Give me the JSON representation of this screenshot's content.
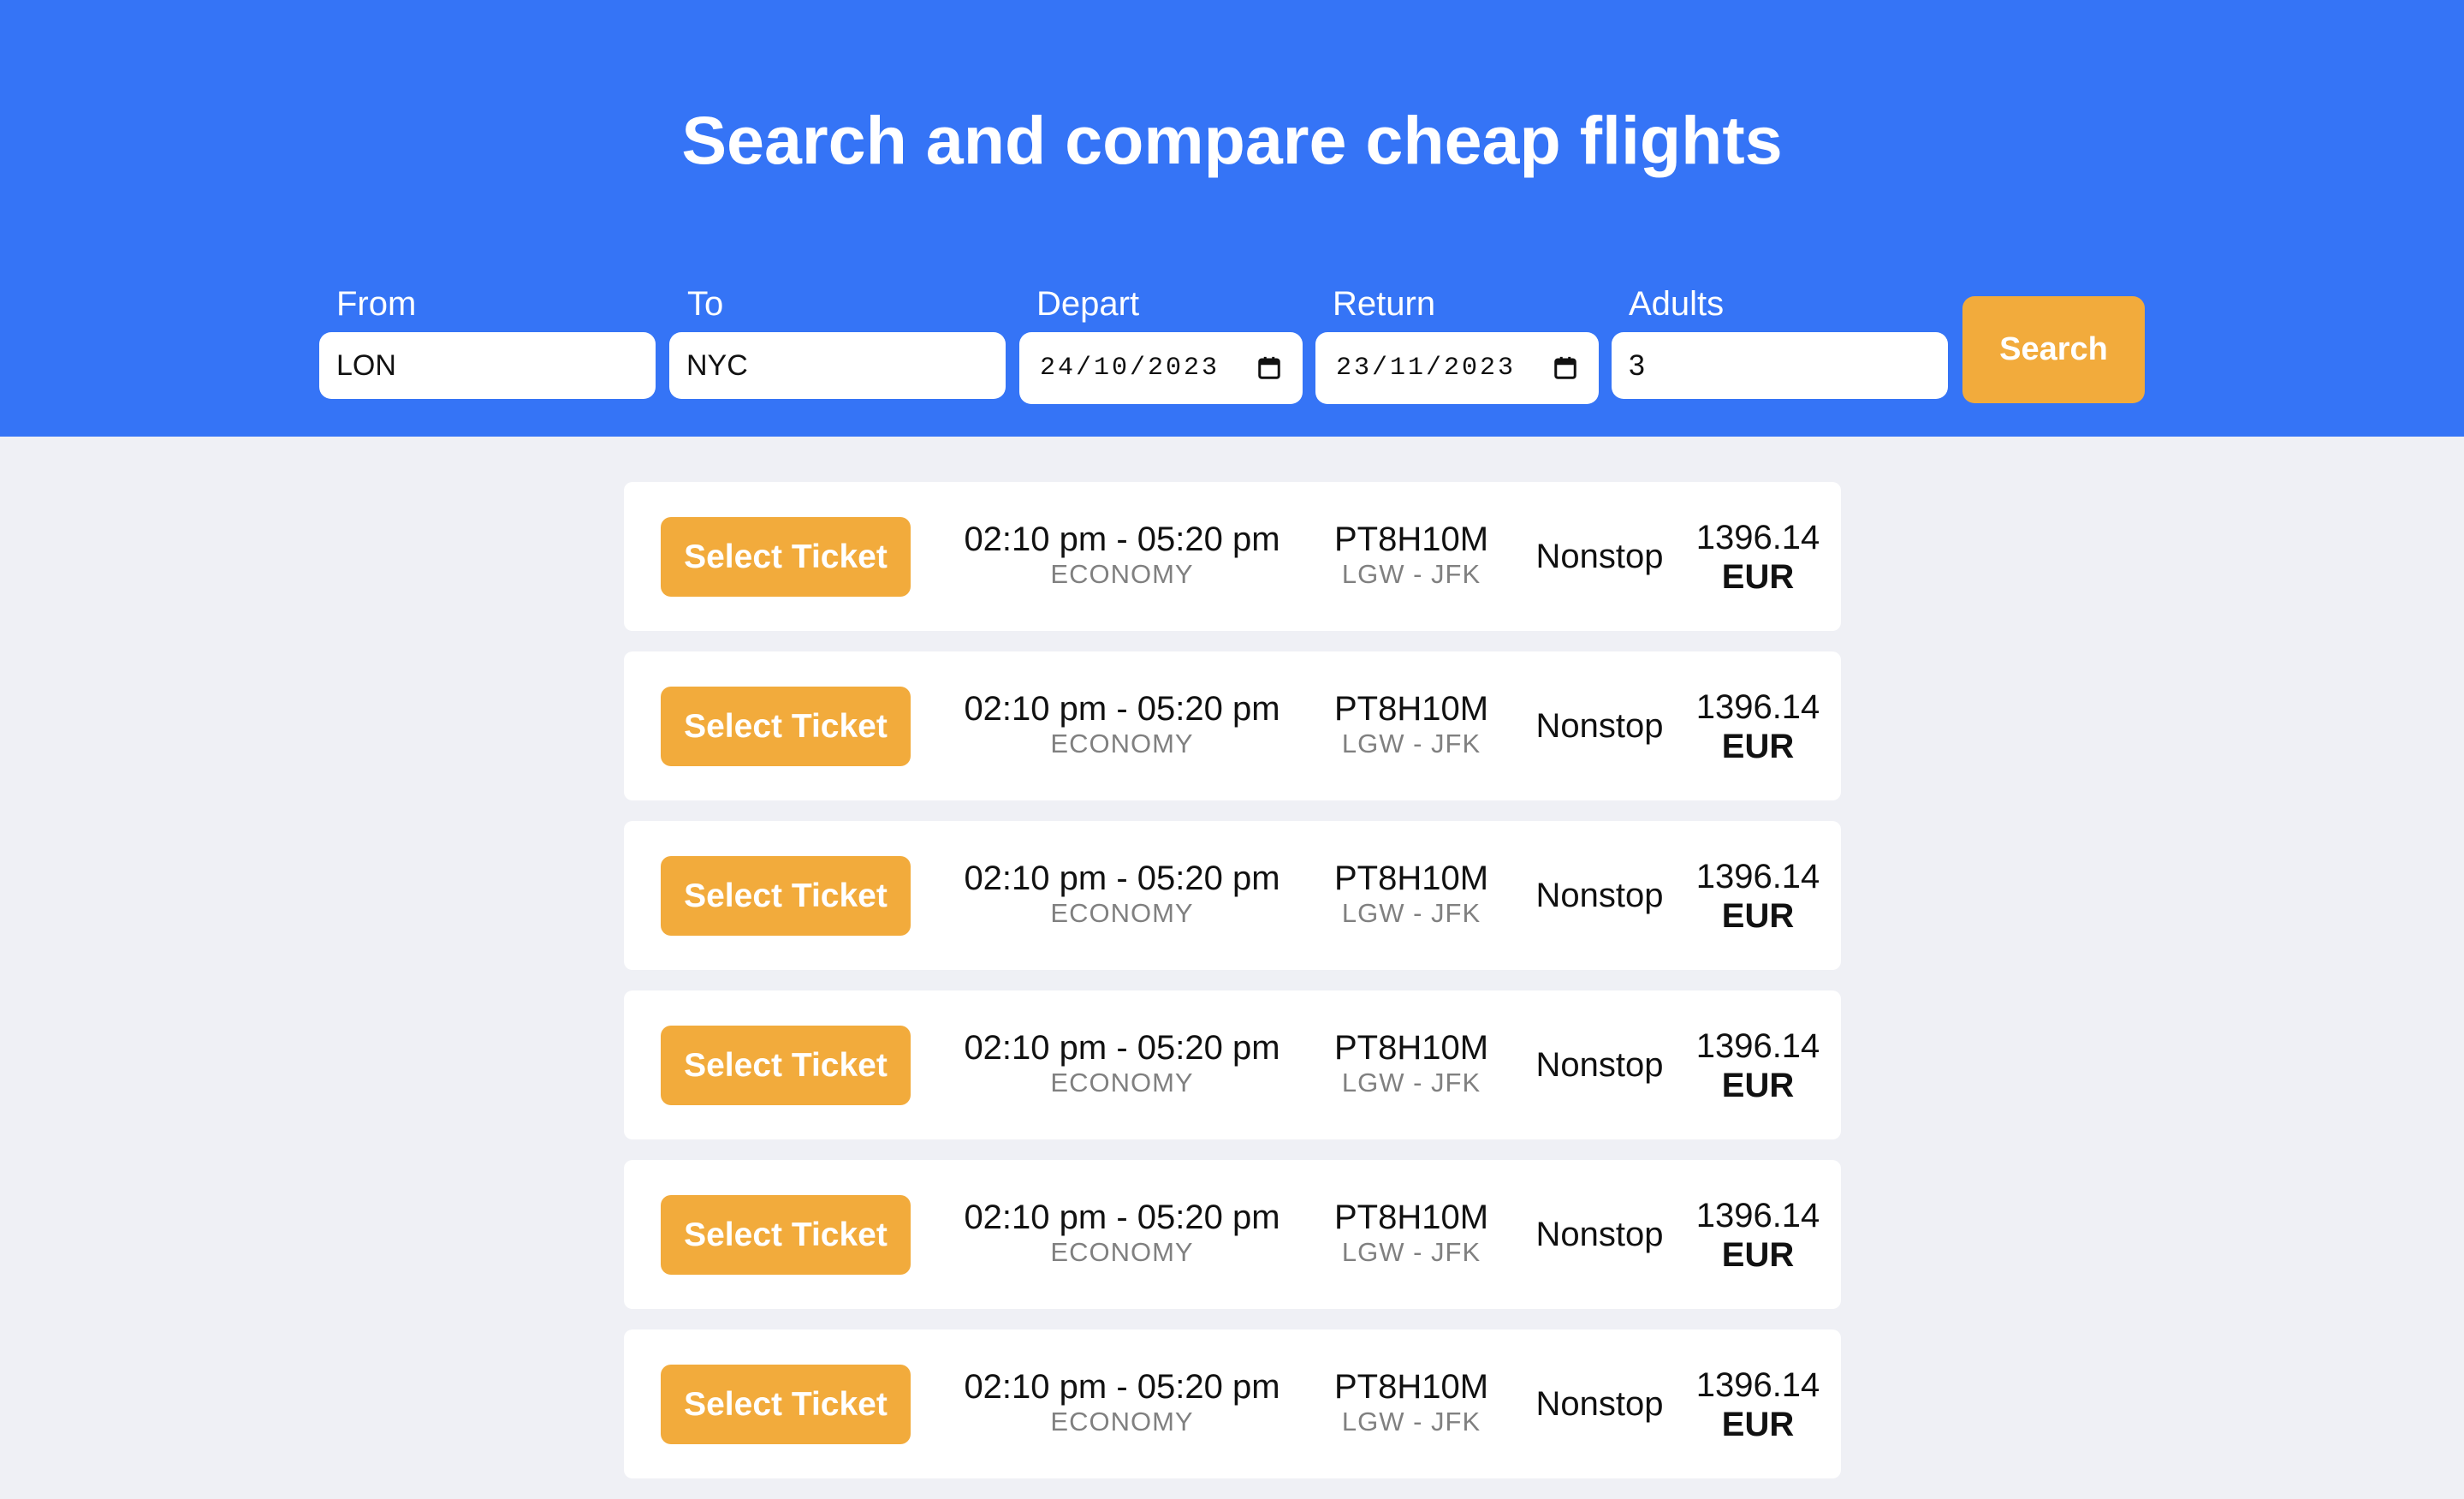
{
  "header": {
    "title": "Search and compare cheap flights",
    "bg_color": "#3574f6"
  },
  "search_form": {
    "from": {
      "label": "From",
      "value": "LON"
    },
    "to": {
      "label": "To",
      "value": "NYC"
    },
    "depart": {
      "label": "Depart",
      "value": "24/10/2023"
    },
    "return": {
      "label": "Return",
      "value": "23/11/2023"
    },
    "adults": {
      "label": "Adults",
      "value": "3"
    },
    "search_label": "Search",
    "accent_color": "#f2ab3c"
  },
  "results": [
    {
      "button_label": "Select Ticket",
      "time": "02:10 pm - 05:20 pm",
      "cabin": "ECONOMY",
      "duration": "PT8H10M",
      "route": "LGW - JFK",
      "stops": "Nonstop",
      "price": "1396.14",
      "currency": "EUR"
    },
    {
      "button_label": "Select Ticket",
      "time": "02:10 pm - 05:20 pm",
      "cabin": "ECONOMY",
      "duration": "PT8H10M",
      "route": "LGW - JFK",
      "stops": "Nonstop",
      "price": "1396.14",
      "currency": "EUR"
    },
    {
      "button_label": "Select Ticket",
      "time": "02:10 pm - 05:20 pm",
      "cabin": "ECONOMY",
      "duration": "PT8H10M",
      "route": "LGW - JFK",
      "stops": "Nonstop",
      "price": "1396.14",
      "currency": "EUR"
    },
    {
      "button_label": "Select Ticket",
      "time": "02:10 pm - 05:20 pm",
      "cabin": "ECONOMY",
      "duration": "PT8H10M",
      "route": "LGW - JFK",
      "stops": "Nonstop",
      "price": "1396.14",
      "currency": "EUR"
    },
    {
      "button_label": "Select Ticket",
      "time": "02:10 pm - 05:20 pm",
      "cabin": "ECONOMY",
      "duration": "PT8H10M",
      "route": "LGW - JFK",
      "stops": "Nonstop",
      "price": "1396.14",
      "currency": "EUR"
    },
    {
      "button_label": "Select Ticket",
      "time": "02:10 pm - 05:20 pm",
      "cabin": "ECONOMY",
      "duration": "PT8H10M",
      "route": "LGW - JFK",
      "stops": "Nonstop",
      "price": "1396.14",
      "currency": "EUR"
    }
  ]
}
